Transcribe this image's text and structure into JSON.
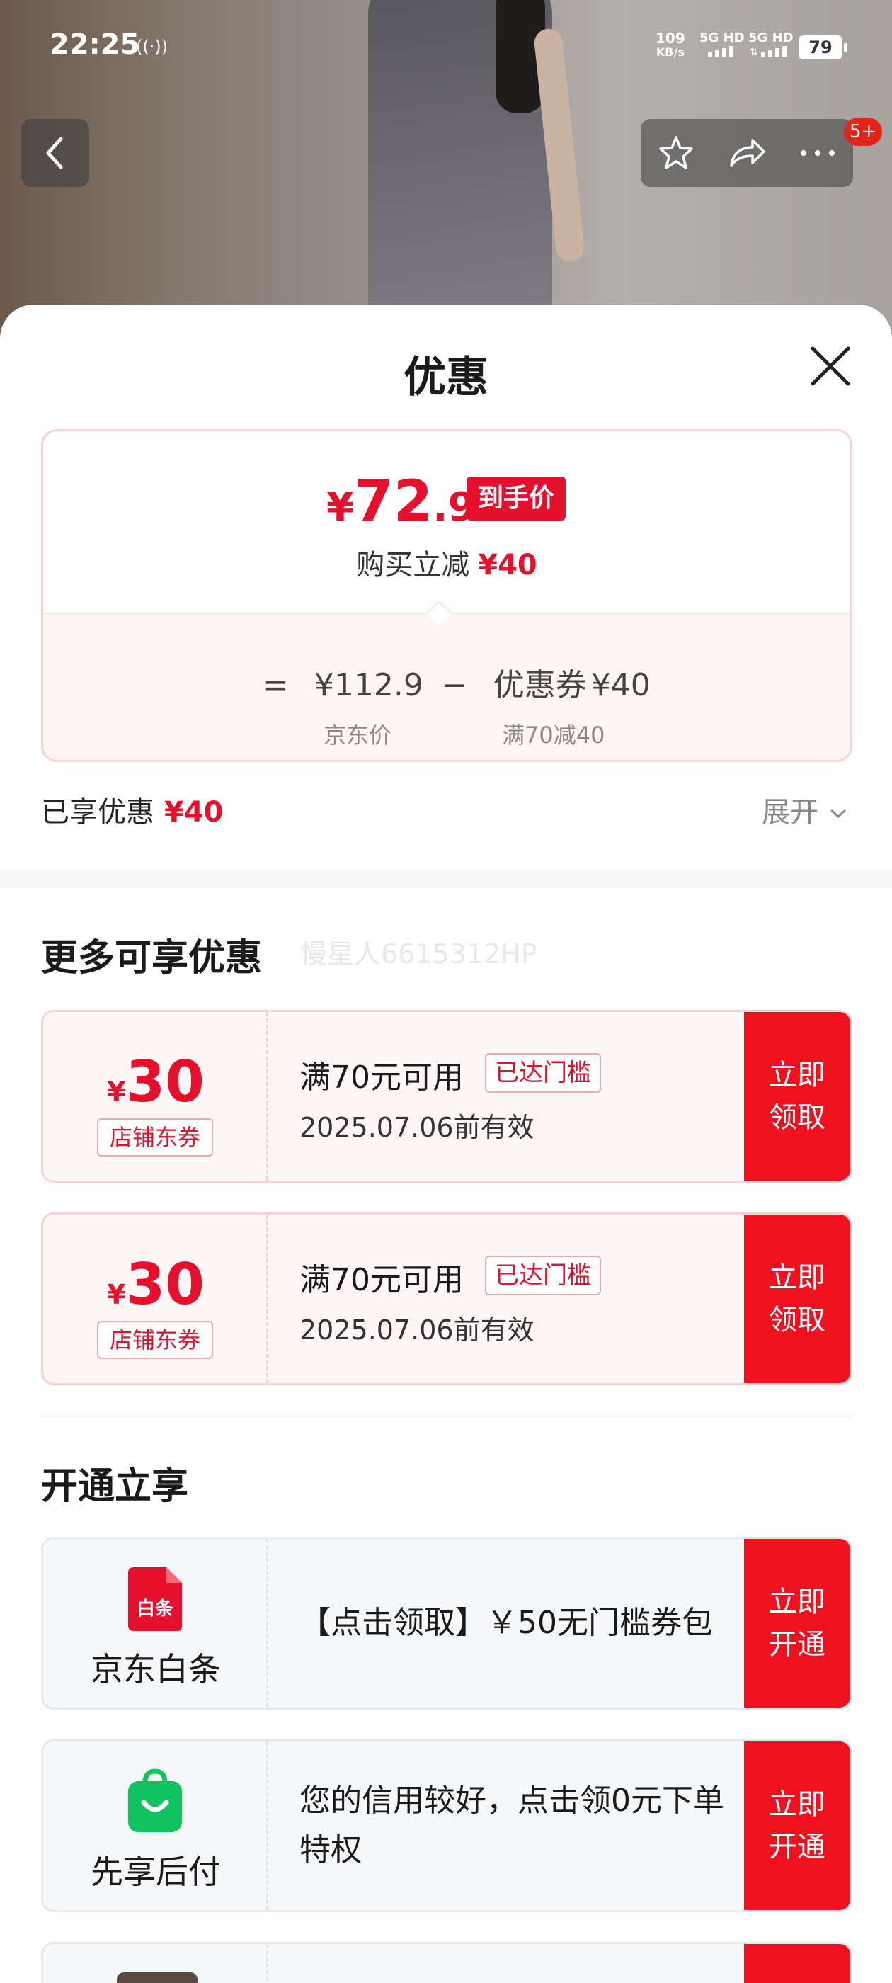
{
  "status_bar": {
    "time": "22:25",
    "nfc": "((·))",
    "net_speed": "109",
    "net_unit": "KB/s",
    "signal1": "5G HD",
    "signal2": "5G HD",
    "battery": "79"
  },
  "nav": {
    "badge": "5+",
    "icons": [
      "back-icon",
      "star-icon",
      "share-icon",
      "more-icon"
    ]
  },
  "sheet": {
    "title": "优惠",
    "close_icon": "close-icon"
  },
  "price_card": {
    "currency": "¥",
    "final_int": "72",
    "final_dec": ".9",
    "final_tag": "到手价",
    "reduce_label": "购买立减",
    "reduce_value": "¥40",
    "eq": "=",
    "jd_price": "¥112.9",
    "minus": "−",
    "coupon_label": "优惠券",
    "coupon_value": "¥40",
    "jd_price_label": "京东价",
    "coupon_cond": "满70减40"
  },
  "enjoyed": {
    "label": "已享优惠",
    "value": "¥40",
    "expand": "展开"
  },
  "more_section": {
    "title": "更多可享优惠",
    "watermark": "慢星人6615312HP",
    "coupons": [
      {
        "currency": "¥",
        "amount": "30",
        "tag": "店铺东券",
        "condition": "满70元可用",
        "reached": "已达门槛",
        "validity": "2025.07.06前有效",
        "cta": "立即\n领取"
      },
      {
        "currency": "¥",
        "amount": "30",
        "tag": "店铺东券",
        "condition": "满70元可用",
        "reached": "已达门槛",
        "validity": "2025.07.06前有效",
        "cta": "立即\n领取"
      }
    ]
  },
  "open_section": {
    "title": "开通立享",
    "services": [
      {
        "name": "京东白条",
        "logo_text": "白条",
        "desc": "【点击领取】￥50无门槛券包",
        "cta": "立即\n开通",
        "color": "#e5112c"
      },
      {
        "name": "先享后付",
        "desc": "您的信用较好，点击领0元下单特权",
        "cta": "立即\n开通",
        "color": "#10c35e"
      }
    ]
  },
  "colors": {
    "accent": "#e5112c",
    "cta": "#f0111f"
  }
}
